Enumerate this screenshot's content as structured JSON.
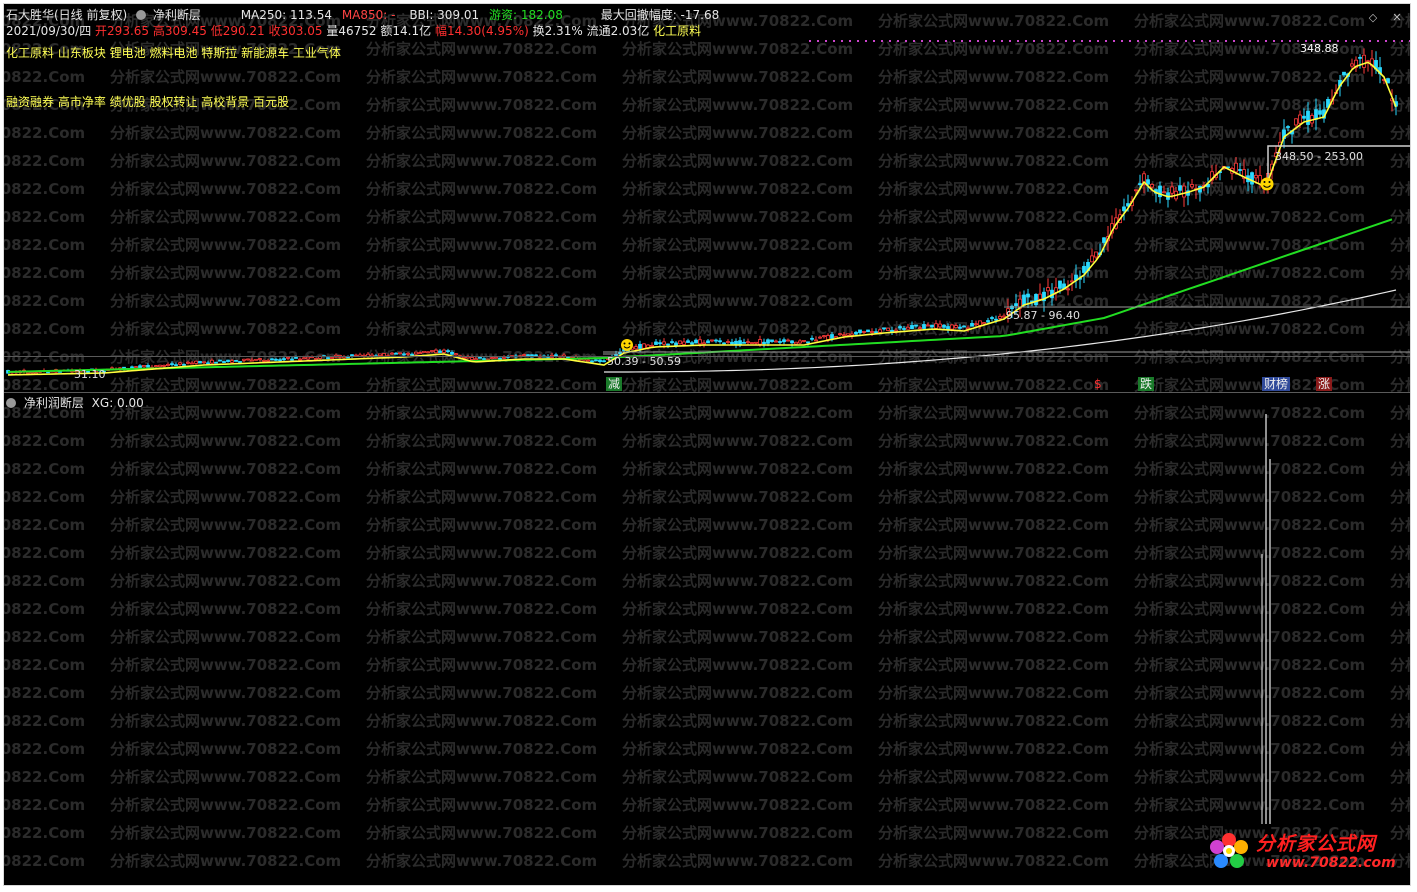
{
  "header": {
    "stock_name": "石大胜华(日线 前复权)",
    "indicator_name": "净利断层",
    "ma250": "MA250: 113.54",
    "ma850": "MA850: -",
    "bbi": "BBI: 309.01",
    "youzi": "游资: 182.08",
    "max_drawdown": "最大回撤幅度: -17.68"
  },
  "quote": {
    "date": "2021/09/30/四",
    "open": "开293.65",
    "high": "高309.45",
    "low": "低290.21",
    "close": "收303.05",
    "volume": "量46752",
    "amount": "额14.1亿",
    "change": "幅14.30(4.95%)",
    "turnover": "换2.31%",
    "float": "流通2.03亿",
    "sector": "化工原料"
  },
  "concepts_line1": "化工原料 山东板块 锂电池 燃料电池 特斯拉 新能源车 工业气体",
  "concepts_line2": "融资融券 高市净率 绩优股 股权转让 高校背景 百元股",
  "annotations": {
    "high_price": "348.88",
    "gap1": "348.50 - 253.00",
    "gap2": "95.87 - 96.40",
    "gap3": "50.39 - 50.59",
    "low_price": "31.10"
  },
  "signals": {
    "jian": "减",
    "dollar": "$",
    "die": "跌",
    "bang": "财榜",
    "zhang": "涨"
  },
  "indicator": {
    "title": "净利润断层",
    "xg": "XG: 0.00"
  },
  "watermark": {
    "text": "分析家公式网www.70822.Com"
  },
  "logo": {
    "title": "分析家公式网",
    "url": "www.70822.com"
  },
  "colors": {
    "up": "#ff3b3b",
    "down": "#2ad9ff",
    "ma_yellow": "#ffff3c",
    "ma_green": "#22dd22",
    "ma_white": "#e8e8e8"
  }
}
